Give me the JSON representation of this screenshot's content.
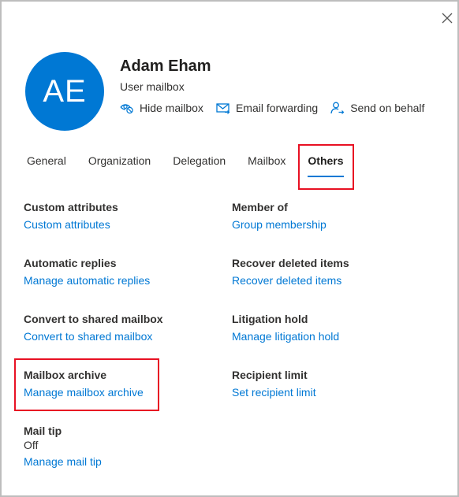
{
  "header": {
    "avatar_initials": "AE",
    "avatar_color": "#0078d4",
    "name": "Adam Eham",
    "type": "User mailbox",
    "actions": [
      {
        "label": "Hide mailbox",
        "icon": "hide-mailbox-icon"
      },
      {
        "label": "Email forwarding",
        "icon": "email-forwarding-icon"
      },
      {
        "label": "Send on behalf",
        "icon": "send-on-behalf-icon"
      }
    ]
  },
  "close_label": "Close",
  "tabs": [
    {
      "label": "General",
      "active": false
    },
    {
      "label": "Organization",
      "active": false
    },
    {
      "label": "Delegation",
      "active": false
    },
    {
      "label": "Mailbox",
      "active": false
    },
    {
      "label": "Others",
      "active": true
    }
  ],
  "sections": {
    "custom_attributes": {
      "title": "Custom attributes",
      "link": "Custom attributes"
    },
    "member_of": {
      "title": "Member of",
      "link": "Group membership"
    },
    "automatic_replies": {
      "title": "Automatic replies",
      "link": "Manage automatic replies"
    },
    "recover_deleted": {
      "title": "Recover deleted items",
      "link": "Recover deleted items"
    },
    "convert_shared": {
      "title": "Convert to shared mailbox",
      "link": "Convert to shared mailbox"
    },
    "litigation_hold": {
      "title": "Litigation hold",
      "link": "Manage litigation hold"
    },
    "mailbox_archive": {
      "title": "Mailbox archive",
      "link": "Manage mailbox archive"
    },
    "recipient_limit": {
      "title": "Recipient limit",
      "link": "Set recipient limit"
    },
    "mail_tip": {
      "title": "Mail tip",
      "value": "Off",
      "link": "Manage mail tip"
    }
  },
  "colors": {
    "accent": "#0078d4",
    "highlight": "#e81123"
  }
}
